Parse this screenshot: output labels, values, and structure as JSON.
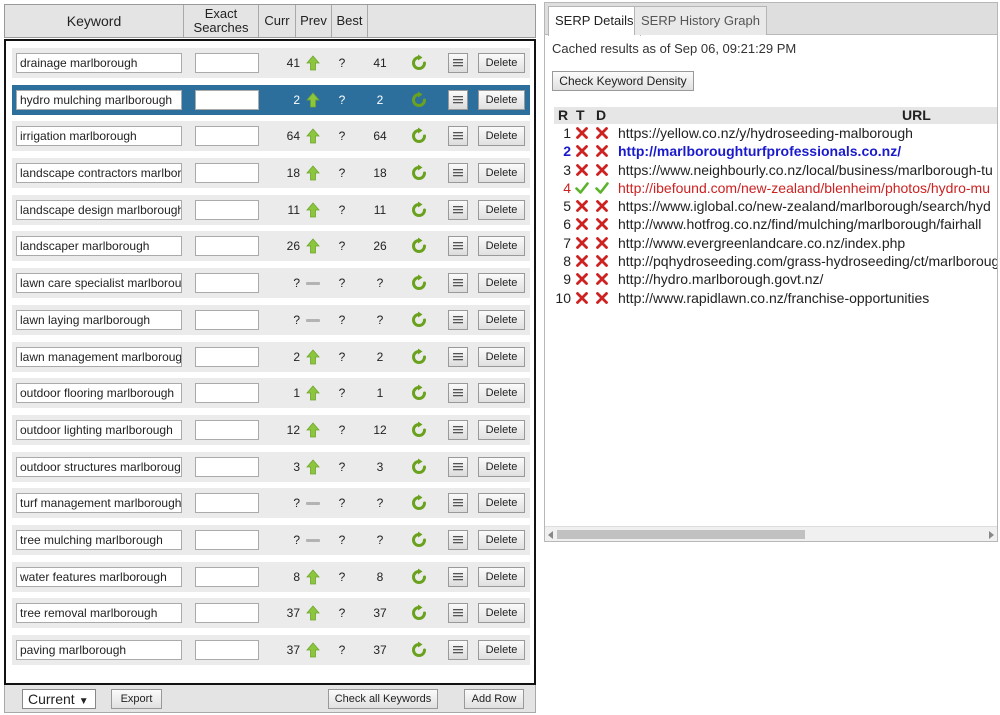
{
  "columns": {
    "keyword": "Keyword",
    "exact": "Exact Searches",
    "curr": "Curr",
    "prev": "Prev",
    "best": "Best"
  },
  "keywords": [
    {
      "keyword": "drainage marlborough",
      "curr": "41",
      "trend": "up",
      "prev": "?",
      "best": "41",
      "selected": false
    },
    {
      "keyword": "hydro mulching marlborough",
      "curr": "2",
      "trend": "up",
      "prev": "?",
      "best": "2",
      "selected": true
    },
    {
      "keyword": "irrigation marlborough",
      "curr": "64",
      "trend": "up",
      "prev": "?",
      "best": "64",
      "selected": false
    },
    {
      "keyword": "landscape contractors marlborou",
      "curr": "18",
      "trend": "up",
      "prev": "?",
      "best": "18",
      "selected": false
    },
    {
      "keyword": "landscape design marlborough",
      "curr": "11",
      "trend": "up",
      "prev": "?",
      "best": "11",
      "selected": false
    },
    {
      "keyword": "landscaper marlborough",
      "curr": "26",
      "trend": "up",
      "prev": "?",
      "best": "26",
      "selected": false
    },
    {
      "keyword": "lawn care specialist marlboroug",
      "curr": "?",
      "trend": "none",
      "prev": "?",
      "best": "?",
      "selected": false
    },
    {
      "keyword": "lawn laying marlborough",
      "curr": "?",
      "trend": "none",
      "prev": "?",
      "best": "?",
      "selected": false
    },
    {
      "keyword": "lawn management marlborough",
      "curr": "2",
      "trend": "up",
      "prev": "?",
      "best": "2",
      "selected": false
    },
    {
      "keyword": "outdoor flooring marlborough",
      "curr": "1",
      "trend": "up",
      "prev": "?",
      "best": "1",
      "selected": false
    },
    {
      "keyword": "outdoor lighting marlborough",
      "curr": "12",
      "trend": "up",
      "prev": "?",
      "best": "12",
      "selected": false
    },
    {
      "keyword": "outdoor structures marlborough",
      "curr": "3",
      "trend": "up",
      "prev": "?",
      "best": "3",
      "selected": false
    },
    {
      "keyword": "turf management marlborough",
      "curr": "?",
      "trend": "none",
      "prev": "?",
      "best": "?",
      "selected": false
    },
    {
      "keyword": "tree mulching marlborough",
      "curr": "?",
      "trend": "none",
      "prev": "?",
      "best": "?",
      "selected": false
    },
    {
      "keyword": "water features marlborough",
      "curr": "8",
      "trend": "up",
      "prev": "?",
      "best": "8",
      "selected": false
    },
    {
      "keyword": "tree removal marlborough",
      "curr": "37",
      "trend": "up",
      "prev": "?",
      "best": "37",
      "selected": false
    },
    {
      "keyword": "paving marlborough",
      "curr": "37",
      "trend": "up",
      "prev": "?",
      "best": "37",
      "selected": false
    }
  ],
  "row_delete_label": "Delete",
  "footer": {
    "current": "Current",
    "export": "Export",
    "check_all": "Check all Keywords",
    "add_row": "Add Row"
  },
  "serp": {
    "tabs": [
      "SERP Details",
      "SERP History Graph"
    ],
    "cached": "Cached results as of Sep 06, 09:21:29 PM",
    "density_button": "Check Keyword Density",
    "headers": {
      "r": "R",
      "t": "T",
      "d": "D",
      "url": "URL"
    },
    "results": [
      {
        "rank": "1",
        "t": false,
        "d": false,
        "url": "https://yellow.co.nz/y/hydroseeding-malborough",
        "style": "normal"
      },
      {
        "rank": "2",
        "t": false,
        "d": false,
        "url": "http://marlboroughturfprofessionals.co.nz/",
        "style": "bold"
      },
      {
        "rank": "3",
        "t": false,
        "d": false,
        "url": "https://www.neighbourly.co.nz/local/business/marlborough-tu",
        "style": "normal"
      },
      {
        "rank": "4",
        "t": true,
        "d": true,
        "url": "http://ibefound.com/new-zealand/blenheim/photos/hydro-mu",
        "style": "red"
      },
      {
        "rank": "5",
        "t": false,
        "d": false,
        "url": "https://www.iglobal.co/new-zealand/marlborough/search/hyd",
        "style": "normal"
      },
      {
        "rank": "6",
        "t": false,
        "d": false,
        "url": "http://www.hotfrog.co.nz/find/mulching/marlborough/fairhall",
        "style": "normal"
      },
      {
        "rank": "7",
        "t": false,
        "d": false,
        "url": "http://www.evergreenlandcare.co.nz/index.php",
        "style": "normal"
      },
      {
        "rank": "8",
        "t": false,
        "d": false,
        "url": "http://pqhydroseeding.com/grass-hydroseeding/ct/marlboroug",
        "style": "normal"
      },
      {
        "rank": "9",
        "t": false,
        "d": false,
        "url": "http://hydro.marlborough.govt.nz/",
        "style": "normal"
      },
      {
        "rank": "10",
        "t": false,
        "d": false,
        "url": "http://www.rapidlawn.co.nz/franchise-opportunities",
        "style": "normal"
      }
    ]
  },
  "colors": {
    "selected_row": "#2c6f9c",
    "trend_up": "#8cc63f",
    "refresh": "#6aa21e",
    "cross": "#cc2222",
    "check": "#5bb32a",
    "bold_link": "#1a1acc"
  }
}
